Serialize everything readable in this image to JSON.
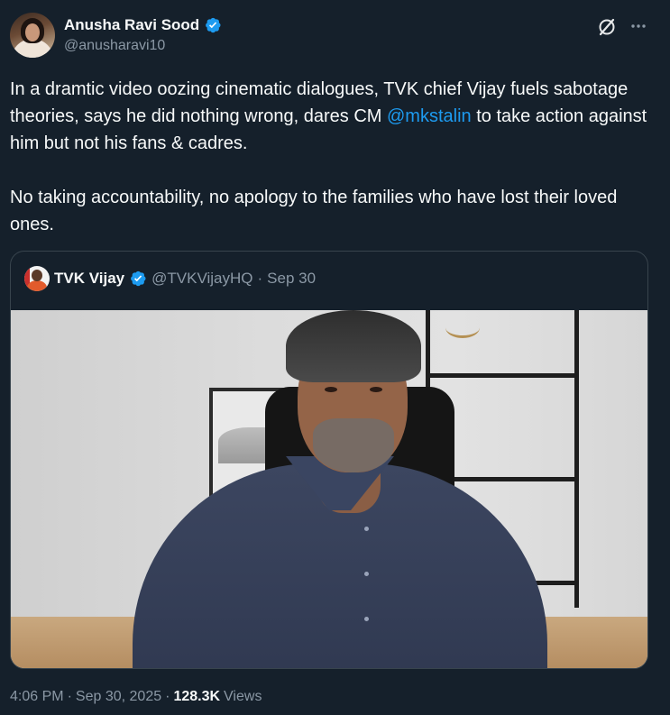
{
  "author": {
    "display_name": "Anusha Ravi Sood",
    "handle": "@anusharavi10",
    "verified": true
  },
  "tweet": {
    "text_part1": "In a dramtic video oozing cinematic dialogues, TVK chief Vijay fuels sabotage theories, says he did nothing wrong, dares CM ",
    "mention": "@mkstalin",
    "text_part2": " to take action against him but not his fans & cadres.",
    "paragraph2": "No taking accountability, no apology to the families who have lost their loved ones."
  },
  "quoted_tweet": {
    "display_name": "TVK Vijay",
    "handle": "@TVKVijayHQ",
    "separator": "·",
    "date": "Sep 30",
    "verified": true,
    "media_type": "video"
  },
  "meta": {
    "time": "4:06 PM",
    "separator": "·",
    "date": "Sep 30, 2025",
    "separator2": "·",
    "views_count": "128.3K",
    "views_label": "Views"
  },
  "icons": {
    "verified": "verified-badge-icon",
    "grok": "grok-icon",
    "more": "more-icon"
  },
  "colors": {
    "background": "#15202b",
    "text": "#f7f9f9",
    "secondary": "#8b98a5",
    "accent": "#1d9bf0",
    "border": "#38444d"
  }
}
